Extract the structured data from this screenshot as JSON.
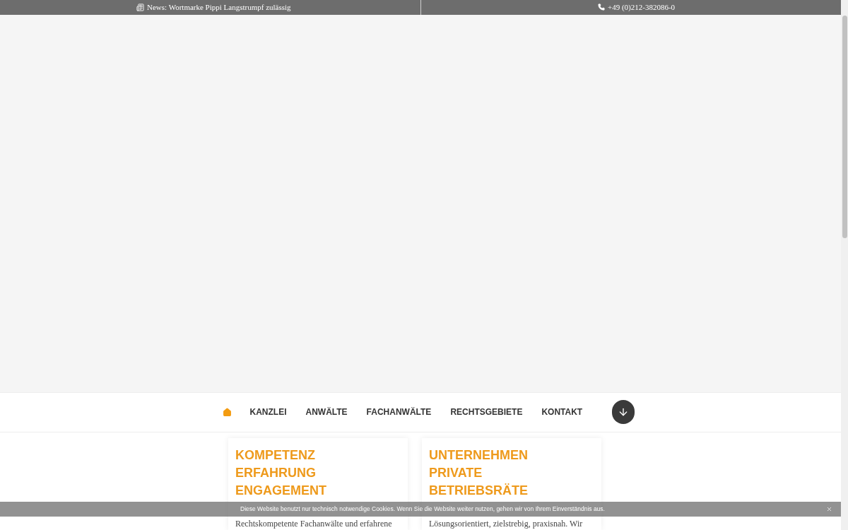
{
  "top_bar": {
    "news": "News: Wortmarke Pippi Langstrumpf zulässig",
    "phone": "+49 (0)212-382086-0"
  },
  "nav": {
    "items": [
      {
        "kind": "home",
        "selected": true
      },
      {
        "kind": "link",
        "label": "KANZLEI",
        "selected": false
      },
      {
        "kind": "link",
        "label": "ANWÄLTE",
        "selected": false
      },
      {
        "kind": "link",
        "label": "FACHANWÄLTE",
        "selected": false
      },
      {
        "kind": "link",
        "label": "RECHTSGEBIETE",
        "selected": false
      },
      {
        "kind": "link",
        "label": "KONTAKT",
        "selected": false
      }
    ]
  },
  "cards": [
    {
      "headings": [
        "KOMPETENZ",
        "ERFAHRUNG",
        "ENGAGEMENT"
      ],
      "text": "Rechtskompetente Fachanwälte und erfahrene"
    },
    {
      "headings": [
        "UNTERNEHMEN",
        "PRIVATE",
        "BETRIEBSRÄTE"
      ],
      "text": "Lösungsorientiert, zielstrebig, praxisnah. Wir"
    }
  ],
  "cookie_banner": {
    "text": "Diese Website benutzt nur technisch notwendige Cookies. Wenn Sie die Website weiter nutzen, gehen wir von Ihrem Einverständnis aus."
  }
}
